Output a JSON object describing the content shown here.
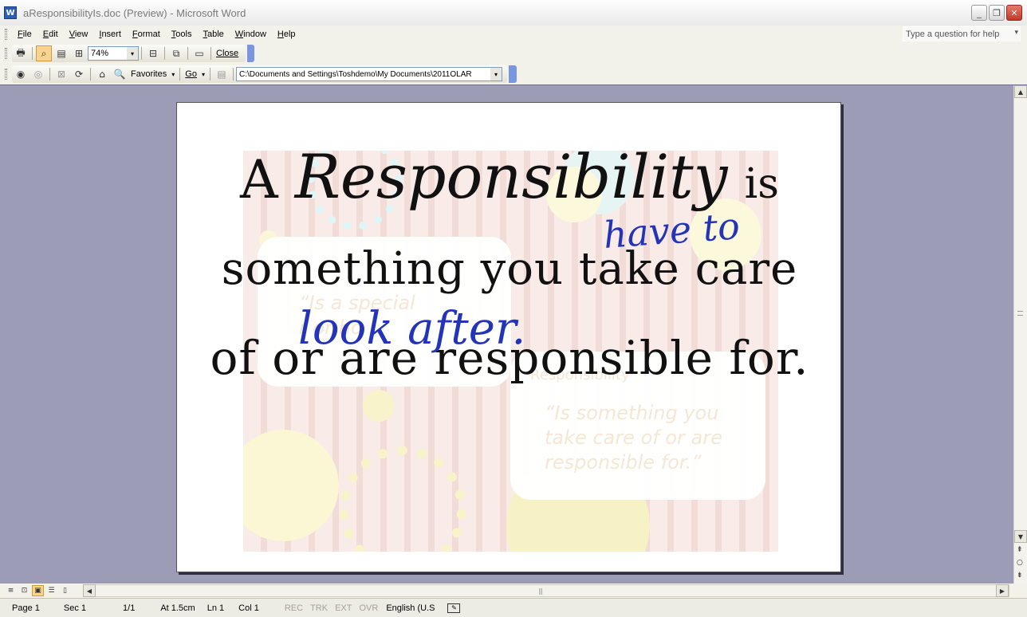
{
  "window": {
    "title": "aResponsibilityIs.doc (Preview) - Microsoft Word",
    "icon": "word-app-icon"
  },
  "menu": {
    "items": [
      "File",
      "Edit",
      "View",
      "Insert",
      "Format",
      "Tools",
      "Table",
      "Window",
      "Help"
    ],
    "help_placeholder": "Type a question for help"
  },
  "preview_toolbar": {
    "zoom": "74%",
    "close_label": "Close"
  },
  "web_toolbar": {
    "favorites_label": "Favorites",
    "go_label": "Go",
    "address": "C:\\Documents and Settings\\Toshdemo\\My Documents\\2011OLAR"
  },
  "document": {
    "line1_a": "A",
    "line1_emph": "Responsibility",
    "line1_is": "is",
    "line2": "something you take care",
    "line3": "of or are responsible for.",
    "handwriting_1": "have to",
    "handwriting_2": "look after.",
    "faint_quote_left": "“Is a special",
    "faint_quote_left_2": "r  or ho",
    "faint_quote_right_1": "“Is something you",
    "faint_quote_right_2": "take care of or are",
    "faint_quote_right_3": "responsible for.”",
    "faint_heading": "Responsibility"
  },
  "statusbar": {
    "page": "Page  1",
    "sec": "Sec  1",
    "pages": "1/1",
    "at": "At  1.5cm",
    "ln": "Ln  1",
    "col": "Col  1",
    "rec": "REC",
    "trk": "TRK",
    "ext": "EXT",
    "ovr": "OVR",
    "language": "English (U.S"
  },
  "colors": {
    "workarea": "#9c9cb7",
    "handwriting": "#2434b8",
    "active_button": "#f9d48d"
  }
}
